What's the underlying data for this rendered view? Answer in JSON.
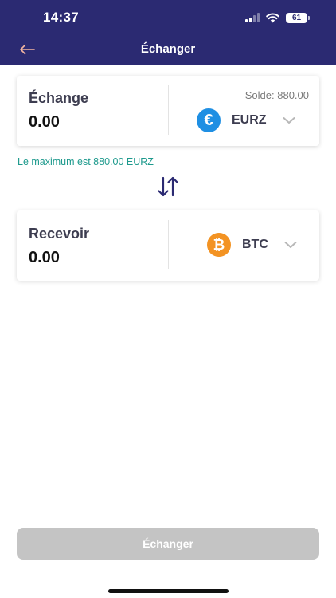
{
  "status_bar": {
    "time": "14:37",
    "battery": "61"
  },
  "header": {
    "title": "Échanger"
  },
  "icons": {
    "back": "arrow-left-icon",
    "swap": "swap-vertical-icon",
    "chevron": "chevron-down-icon",
    "euro": "euro-coin-icon",
    "bitcoin": "bitcoin-coin-icon"
  },
  "colors": {
    "header_bg": "#2b2a72",
    "back_arrow": "#f3b5a0",
    "eur_coin": "#1f8fe3",
    "btc_coin": "#f39323",
    "note_text": "#1e9a8d",
    "button_disabled": "#c4c4c4"
  },
  "from_card": {
    "label": "Échange",
    "amount": "0.00",
    "balance": "Solde: 880.00",
    "currency": "EURZ",
    "coin_symbol": "€"
  },
  "max_note": "Le maximum est 880.00 EURZ",
  "to_card": {
    "label": "Recevoir",
    "amount": "0.00",
    "currency": "BTC",
    "coin_symbol": "₿"
  },
  "submit": {
    "label": "Échanger",
    "enabled": false
  }
}
